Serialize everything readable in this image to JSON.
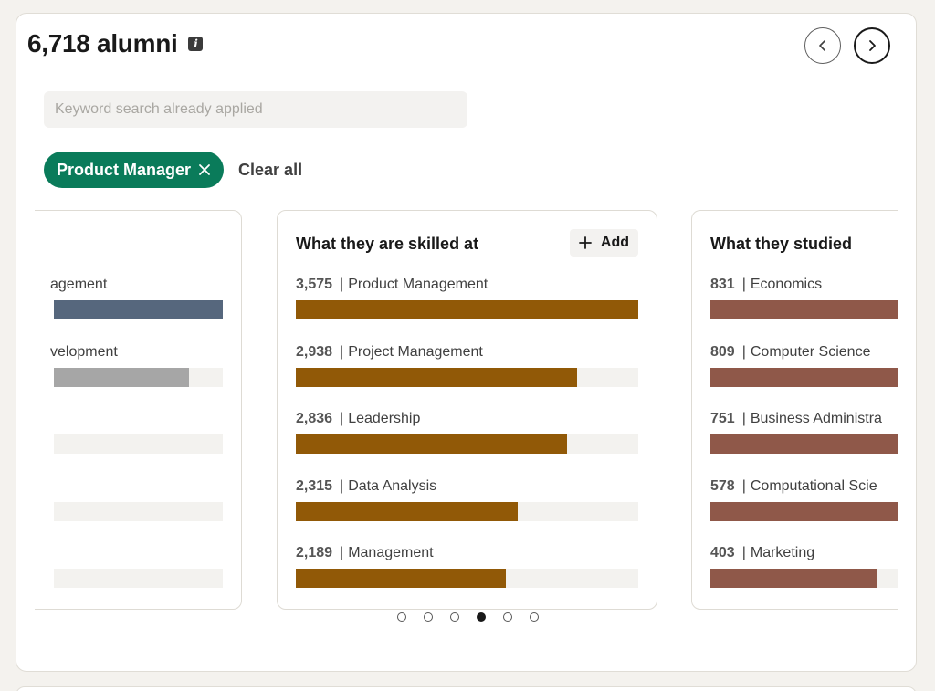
{
  "header": {
    "count_title": "6,718 alumni",
    "info_icon": "info-icon",
    "prev_icon": "chevron-left-icon",
    "next_icon": "chevron-right-icon"
  },
  "search": {
    "placeholder": "Keyword search already applied",
    "value": ""
  },
  "filters": {
    "active": [
      {
        "label": "Product Manager",
        "color": "#0a7b5a"
      }
    ],
    "clear_label": "Clear all"
  },
  "cards": [
    {
      "title": "",
      "color": "#56677d",
      "partial": "left",
      "rows": [
        {
          "label": "agement",
          "fraction": 1.0,
          "color": "#56677d"
        },
        {
          "label": "velopment",
          "fraction": 0.8,
          "color": "#a6a6a6"
        },
        {
          "label": "",
          "fraction": 0
        },
        {
          "label": "",
          "fraction": 0
        },
        {
          "label": "",
          "fraction": 0
        }
      ]
    },
    {
      "title": "What they are skilled at",
      "add_label": "Add",
      "color": "#915907",
      "rows": [
        {
          "count": "3,575",
          "label": "Product Management",
          "value": 3575
        },
        {
          "count": "2,938",
          "label": "Project Management",
          "value": 2938
        },
        {
          "count": "2,836",
          "label": "Leadership",
          "value": 2836
        },
        {
          "count": "2,315",
          "label": "Data Analysis",
          "value": 2315
        },
        {
          "count": "2,189",
          "label": "Management",
          "value": 2189
        }
      ]
    },
    {
      "title": "What they studied",
      "color": "#8f5849",
      "partial": "right",
      "rows": [
        {
          "count": "831",
          "label": "Economics",
          "value": 831
        },
        {
          "count": "809",
          "label": "Computer Science",
          "value": 809
        },
        {
          "count": "751",
          "label": "Business Administra",
          "value": 751
        },
        {
          "count": "578",
          "label": "Computational Scie",
          "value": 578
        },
        {
          "count": "403",
          "label": "Marketing",
          "value": 403
        }
      ]
    }
  ],
  "pagination": {
    "total": 6,
    "active_index": 3
  }
}
